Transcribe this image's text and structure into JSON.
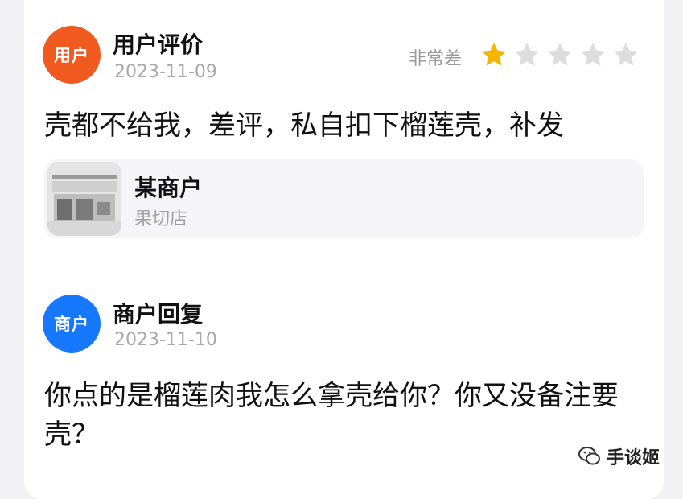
{
  "review": {
    "avatar_text": "用户",
    "author": "用户评价",
    "date": "2023-11-09",
    "rating_label": "非常差",
    "rating": 1,
    "rating_max": 5,
    "text": "壳都不给我，差评，私自扣下榴莲壳，补发"
  },
  "store": {
    "name": "某商户",
    "subtitle": "果切店"
  },
  "reply": {
    "avatar_text": "商户",
    "author": "商户回复",
    "date": "2023-11-10",
    "text": "你点的是榴莲肉我怎么拿壳给你？你又没备注要壳？"
  },
  "watermark": {
    "text": "手谈姬"
  },
  "colors": {
    "user_avatar": "#f15a1f",
    "merchant_avatar": "#1677ff",
    "star_filled": "#f7b500",
    "star_empty": "#dddddd"
  }
}
